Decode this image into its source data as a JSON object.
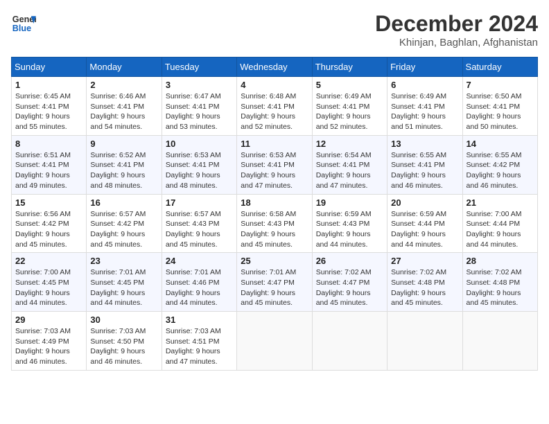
{
  "header": {
    "logo_line1": "General",
    "logo_line2": "Blue",
    "month_year": "December 2024",
    "location": "Khinjan, Baghlan, Afghanistan"
  },
  "days_of_week": [
    "Sunday",
    "Monday",
    "Tuesday",
    "Wednesday",
    "Thursday",
    "Friday",
    "Saturday"
  ],
  "weeks": [
    [
      {
        "day": "1",
        "sunrise": "6:45 AM",
        "sunset": "4:41 PM",
        "daylight": "9 hours and 55 minutes."
      },
      {
        "day": "2",
        "sunrise": "6:46 AM",
        "sunset": "4:41 PM",
        "daylight": "9 hours and 54 minutes."
      },
      {
        "day": "3",
        "sunrise": "6:47 AM",
        "sunset": "4:41 PM",
        "daylight": "9 hours and 53 minutes."
      },
      {
        "day": "4",
        "sunrise": "6:48 AM",
        "sunset": "4:41 PM",
        "daylight": "9 hours and 52 minutes."
      },
      {
        "day": "5",
        "sunrise": "6:49 AM",
        "sunset": "4:41 PM",
        "daylight": "9 hours and 52 minutes."
      },
      {
        "day": "6",
        "sunrise": "6:49 AM",
        "sunset": "4:41 PM",
        "daylight": "9 hours and 51 minutes."
      },
      {
        "day": "7",
        "sunrise": "6:50 AM",
        "sunset": "4:41 PM",
        "daylight": "9 hours and 50 minutes."
      }
    ],
    [
      {
        "day": "8",
        "sunrise": "6:51 AM",
        "sunset": "4:41 PM",
        "daylight": "9 hours and 49 minutes."
      },
      {
        "day": "9",
        "sunrise": "6:52 AM",
        "sunset": "4:41 PM",
        "daylight": "9 hours and 48 minutes."
      },
      {
        "day": "10",
        "sunrise": "6:53 AM",
        "sunset": "4:41 PM",
        "daylight": "9 hours and 48 minutes."
      },
      {
        "day": "11",
        "sunrise": "6:53 AM",
        "sunset": "4:41 PM",
        "daylight": "9 hours and 47 minutes."
      },
      {
        "day": "12",
        "sunrise": "6:54 AM",
        "sunset": "4:41 PM",
        "daylight": "9 hours and 47 minutes."
      },
      {
        "day": "13",
        "sunrise": "6:55 AM",
        "sunset": "4:41 PM",
        "daylight": "9 hours and 46 minutes."
      },
      {
        "day": "14",
        "sunrise": "6:55 AM",
        "sunset": "4:42 PM",
        "daylight": "9 hours and 46 minutes."
      }
    ],
    [
      {
        "day": "15",
        "sunrise": "6:56 AM",
        "sunset": "4:42 PM",
        "daylight": "9 hours and 45 minutes."
      },
      {
        "day": "16",
        "sunrise": "6:57 AM",
        "sunset": "4:42 PM",
        "daylight": "9 hours and 45 minutes."
      },
      {
        "day": "17",
        "sunrise": "6:57 AM",
        "sunset": "4:43 PM",
        "daylight": "9 hours and 45 minutes."
      },
      {
        "day": "18",
        "sunrise": "6:58 AM",
        "sunset": "4:43 PM",
        "daylight": "9 hours and 45 minutes."
      },
      {
        "day": "19",
        "sunrise": "6:59 AM",
        "sunset": "4:43 PM",
        "daylight": "9 hours and 44 minutes."
      },
      {
        "day": "20",
        "sunrise": "6:59 AM",
        "sunset": "4:44 PM",
        "daylight": "9 hours and 44 minutes."
      },
      {
        "day": "21",
        "sunrise": "7:00 AM",
        "sunset": "4:44 PM",
        "daylight": "9 hours and 44 minutes."
      }
    ],
    [
      {
        "day": "22",
        "sunrise": "7:00 AM",
        "sunset": "4:45 PM",
        "daylight": "9 hours and 44 minutes."
      },
      {
        "day": "23",
        "sunrise": "7:01 AM",
        "sunset": "4:45 PM",
        "daylight": "9 hours and 44 minutes."
      },
      {
        "day": "24",
        "sunrise": "7:01 AM",
        "sunset": "4:46 PM",
        "daylight": "9 hours and 44 minutes."
      },
      {
        "day": "25",
        "sunrise": "7:01 AM",
        "sunset": "4:47 PM",
        "daylight": "9 hours and 45 minutes."
      },
      {
        "day": "26",
        "sunrise": "7:02 AM",
        "sunset": "4:47 PM",
        "daylight": "9 hours and 45 minutes."
      },
      {
        "day": "27",
        "sunrise": "7:02 AM",
        "sunset": "4:48 PM",
        "daylight": "9 hours and 45 minutes."
      },
      {
        "day": "28",
        "sunrise": "7:02 AM",
        "sunset": "4:48 PM",
        "daylight": "9 hours and 45 minutes."
      }
    ],
    [
      {
        "day": "29",
        "sunrise": "7:03 AM",
        "sunset": "4:49 PM",
        "daylight": "9 hours and 46 minutes."
      },
      {
        "day": "30",
        "sunrise": "7:03 AM",
        "sunset": "4:50 PM",
        "daylight": "9 hours and 46 minutes."
      },
      {
        "day": "31",
        "sunrise": "7:03 AM",
        "sunset": "4:51 PM",
        "daylight": "9 hours and 47 minutes."
      },
      null,
      null,
      null,
      null
    ]
  ]
}
